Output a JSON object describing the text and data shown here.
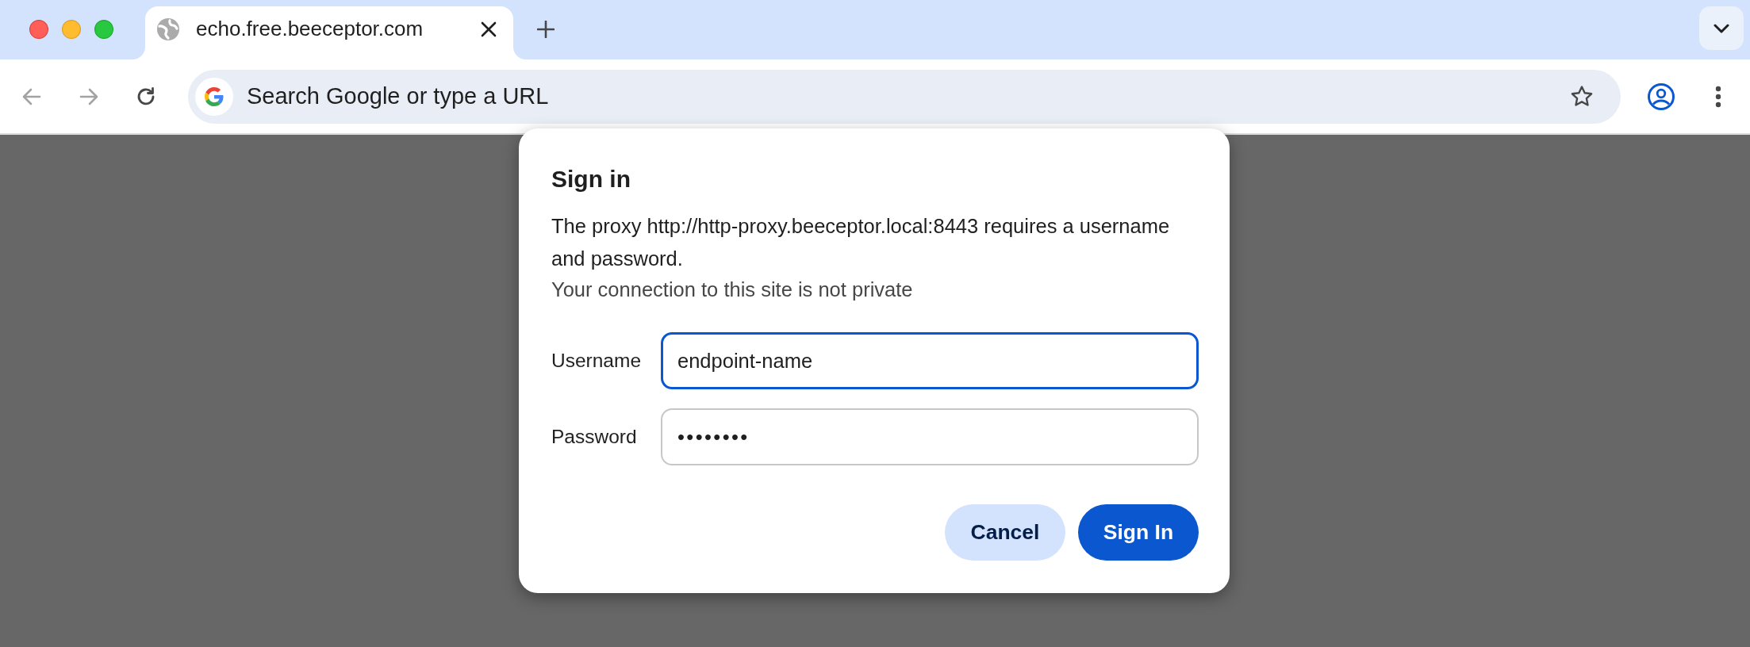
{
  "tabs": [
    {
      "title": "echo.free.beeceptor.com",
      "selected": true
    }
  ],
  "toolbar": {
    "nav_buttons": [
      {
        "kind": "back",
        "disabled": true
      },
      {
        "kind": "forward",
        "disabled": true
      },
      {
        "kind": "reload",
        "disabled": false
      }
    ],
    "address_bar": {
      "placeholder": "Search Google or type a URL"
    }
  },
  "dialog": {
    "title": "Sign in",
    "message": "The proxy http://http-proxy.beeceptor.local:8443 requires a username and password.",
    "note": "Your connection to this site is not private",
    "fields": [
      {
        "label": "Username",
        "kind": "text",
        "value": "endpoint-name",
        "focused": true
      },
      {
        "label": "Password",
        "kind": "password",
        "value": "••••••••",
        "focused": false
      }
    ],
    "buttons": [
      {
        "label": "Cancel",
        "kind": "secondary"
      },
      {
        "label": "Sign In",
        "kind": "primary"
      }
    ]
  }
}
